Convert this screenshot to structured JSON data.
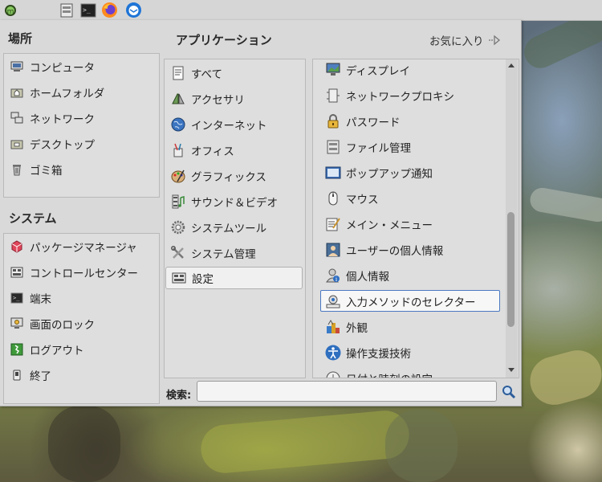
{
  "panel": {
    "icons": [
      "mint-logo-icon",
      "file-manager-icon",
      "terminal-icon",
      "firefox-icon",
      "thunderbird-icon"
    ]
  },
  "places": {
    "title": "場所",
    "items": [
      {
        "label": "コンピュータ",
        "icon": "computer-icon"
      },
      {
        "label": "ホームフォルダ",
        "icon": "home-folder-icon"
      },
      {
        "label": "ネットワーク",
        "icon": "network-icon"
      },
      {
        "label": "デスクトップ",
        "icon": "desktop-folder-icon"
      },
      {
        "label": "ゴミ箱",
        "icon": "trash-icon"
      }
    ]
  },
  "system": {
    "title": "システム",
    "items": [
      {
        "label": "パッケージマネージャ",
        "icon": "package-manager-icon"
      },
      {
        "label": "コントロールセンター",
        "icon": "control-center-icon"
      },
      {
        "label": "端末",
        "icon": "terminal-icon"
      },
      {
        "label": "画面のロック",
        "icon": "lock-screen-icon"
      },
      {
        "label": "ログアウト",
        "icon": "logout-icon"
      },
      {
        "label": "終了",
        "icon": "shutdown-icon"
      }
    ]
  },
  "applications": {
    "title": "アプリケーション",
    "favorites_label": "お気に入り",
    "categories": [
      {
        "label": "すべて",
        "icon": "all-apps-icon"
      },
      {
        "label": "アクセサリ",
        "icon": "accessories-icon"
      },
      {
        "label": "インターネット",
        "icon": "internet-globe-icon"
      },
      {
        "label": "オフィス",
        "icon": "office-icon"
      },
      {
        "label": "グラフィックス",
        "icon": "graphics-palette-icon"
      },
      {
        "label": "サウンド＆ビデオ",
        "icon": "multimedia-icon"
      },
      {
        "label": "システムツール",
        "icon": "system-tools-gear-icon"
      },
      {
        "label": "システム管理",
        "icon": "administration-tools-icon"
      },
      {
        "label": "設定",
        "icon": "settings-icon"
      }
    ],
    "selected_category": "設定",
    "apps": [
      {
        "label": "ディスプレイ",
        "icon": "display-icon"
      },
      {
        "label": "ネットワークプロキシ",
        "icon": "network-proxy-icon"
      },
      {
        "label": "パスワード",
        "icon": "password-lock-icon"
      },
      {
        "label": "ファイル管理",
        "icon": "file-management-icon"
      },
      {
        "label": "ポップアップ通知",
        "icon": "popup-notification-icon"
      },
      {
        "label": "マウス",
        "icon": "mouse-icon"
      },
      {
        "label": "メイン・メニュー",
        "icon": "main-menu-editor-icon"
      },
      {
        "label": "ユーザーの個人情報",
        "icon": "user-info-icon"
      },
      {
        "label": "個人情報",
        "icon": "personal-info-icon"
      },
      {
        "label": "入力メソッドのセレクター",
        "icon": "input-method-icon"
      },
      {
        "label": "外観",
        "icon": "appearance-icon"
      },
      {
        "label": "操作支援技術",
        "icon": "accessibility-icon"
      },
      {
        "label": "日付と時刻の設定",
        "icon": "date-time-icon"
      }
    ],
    "focused_app": "入力メソッドのセレクター"
  },
  "search": {
    "label": "検索:",
    "value": "",
    "placeholder": ""
  }
}
